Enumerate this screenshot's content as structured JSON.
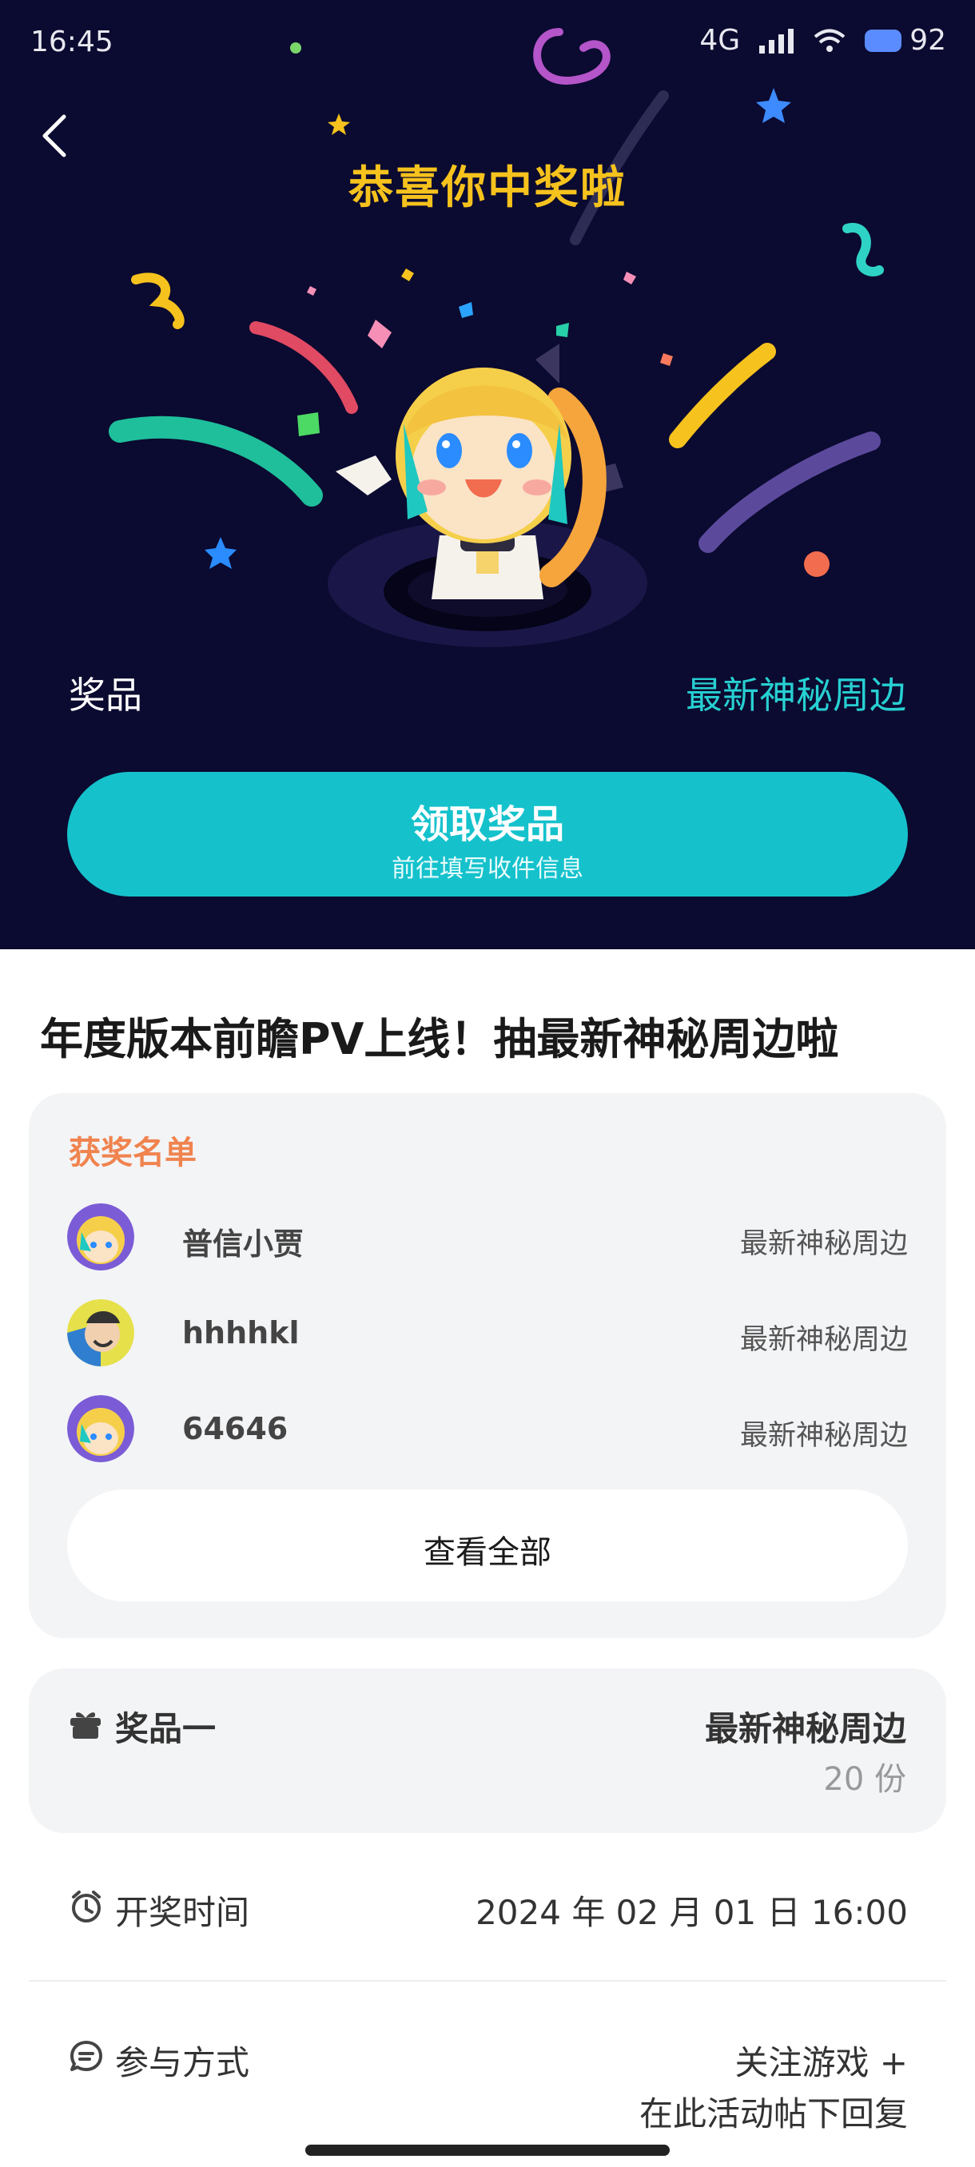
{
  "status_bar": {
    "time": "16:45",
    "signal": "4G",
    "battery": "92"
  },
  "hero": {
    "title": "恭喜你中奖啦",
    "prize_label": "奖品",
    "prize_value": "最新神秘周边",
    "claim_button": {
      "label": "领取奖品",
      "sub_label": "前往填写收件信息"
    }
  },
  "event_title": "年度版本前瞻PV上线！抽最新神秘周边啦",
  "winners": {
    "title": "获奖名单",
    "list": [
      {
        "name": "普信小贾",
        "prize": "最新神秘周边"
      },
      {
        "name": "hhhhkl",
        "prize": "最新神秘周边"
      },
      {
        "name": "64646",
        "prize": "最新神秘周边"
      }
    ],
    "view_all": "查看全部"
  },
  "prize_card": {
    "label": "奖品一",
    "name": "最新神秘周边",
    "count": "20 份"
  },
  "draw_time": {
    "label": "开奖时间",
    "value": "2024 年 02 月 01 日 16:00"
  },
  "participation": {
    "label": "参与方式",
    "line1": "关注游戏 +",
    "line2": "在此活动帖下回复"
  },
  "colors": {
    "hero_bg": "#0b0a30",
    "accent_yellow": "#f6c21d",
    "accent_cyan": "#15c2cc",
    "winners_title": "#f0834e"
  }
}
